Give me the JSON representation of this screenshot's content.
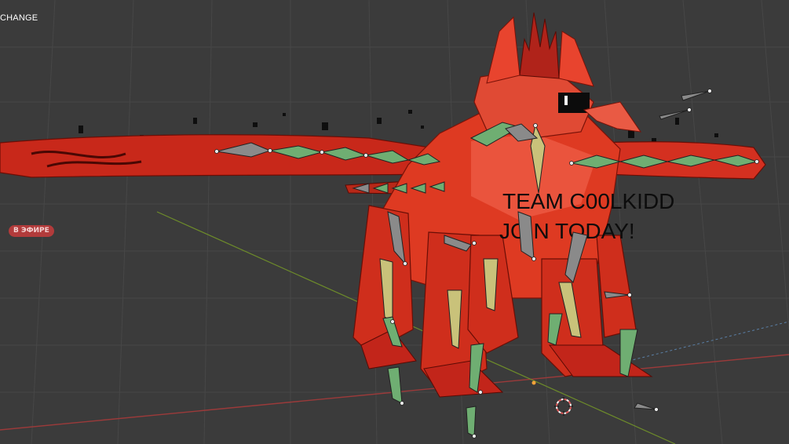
{
  "viewport": {
    "header_label": "CHANGE",
    "live_badge": "В ЭФИРЕ",
    "overlay_text": [
      "TEAM C00LKIDD",
      "JOIN TODAY!"
    ]
  },
  "colors": {
    "background": "#3b3b3b",
    "grid_line": "#444444",
    "axis_x": "#9b3a3a",
    "axis_y": "#6d8b2a",
    "mesh_red": "#d83218",
    "mesh_dark": "#7a1208",
    "bone_gray": "#8a8a8a",
    "bone_green": "#6fae72",
    "bone_yellow": "#c9c27a",
    "cursor": "#e05a5a"
  },
  "icons": [
    "3d-cursor-icon",
    "origin-point-icon"
  ]
}
